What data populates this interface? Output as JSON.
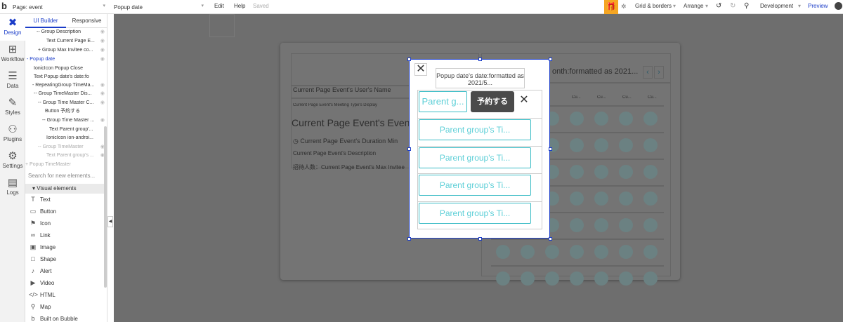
{
  "topbar": {
    "page_select": "Page: event",
    "element_select": "Popup date",
    "edit": "Edit",
    "help": "Help",
    "saved": "Saved",
    "grid_borders": "Grid & borders",
    "arrange": "Arrange",
    "environment": "Development",
    "preview": "Preview"
  },
  "sidebar": {
    "items": [
      {
        "label": "Design",
        "icon": "design-icon"
      },
      {
        "label": "Workflow",
        "icon": "workflow-icon"
      },
      {
        "label": "Data",
        "icon": "data-icon"
      },
      {
        "label": "Styles",
        "icon": "styles-icon"
      },
      {
        "label": "Plugins",
        "icon": "plugins-icon"
      },
      {
        "label": "Settings",
        "icon": "settings-icon"
      },
      {
        "label": "Logs",
        "icon": "logs-icon"
      }
    ]
  },
  "panel": {
    "tab_ui_builder": "UI Builder",
    "tab_responsive": "Responsive",
    "tree": [
      "-- Group Description",
      "Text Current Page E...",
      "+ Group Max Invitee co...",
      "- Popup date",
      "IonicIcon Popup Close",
      "Text Popup date's date:fo",
      "- RepeatingGroup TimeMa...",
      "-- Group TimeMaster Dis...",
      "-- Group Time Master C...",
      "Button 予約する",
      "-- Group Time Master ...",
      "Text Parent group'...",
      "IonicIcon ion-androi...",
      "-- Group TimeMaster",
      "Text Parent group's ...",
      "+ Popup TimeMaster"
    ],
    "search_placeholder": "Search for new elements...",
    "visual_header": "Visual elements",
    "elements": [
      {
        "label": "Text",
        "icon": "text-icon"
      },
      {
        "label": "Button",
        "icon": "button-icon"
      },
      {
        "label": "Icon",
        "icon": "flag-icon"
      },
      {
        "label": "Link",
        "icon": "link-icon"
      },
      {
        "label": "Image",
        "icon": "image-icon"
      },
      {
        "label": "Shape",
        "icon": "shape-icon"
      },
      {
        "label": "Alert",
        "icon": "bell-icon"
      },
      {
        "label": "Video",
        "icon": "video-icon"
      },
      {
        "label": "HTML",
        "icon": "code-icon"
      },
      {
        "label": "Map",
        "icon": "map-pin-icon"
      },
      {
        "label": "Built on Bubble",
        "icon": "bubble-icon"
      }
    ]
  },
  "page": {
    "user_name": "Current Page Event's User's Name",
    "meeting_type": "Current Page Event's Meeting Type's Display",
    "event_title": "Current Page Event's Event",
    "duration": "Current Page Event's Duration Min",
    "description": "Current Page Event's Description",
    "max_invitee": "招待人数：Current Page Event's Max Invitee",
    "month_label": "onth:formatted as 2021...",
    "col_header": "Cu..."
  },
  "popup": {
    "date_text": "Popup date's date:formatted as 2021/5...",
    "slot_first": "Parent g...",
    "reserve_button": "予約する",
    "slot_text": "Parent group's Ti..."
  }
}
